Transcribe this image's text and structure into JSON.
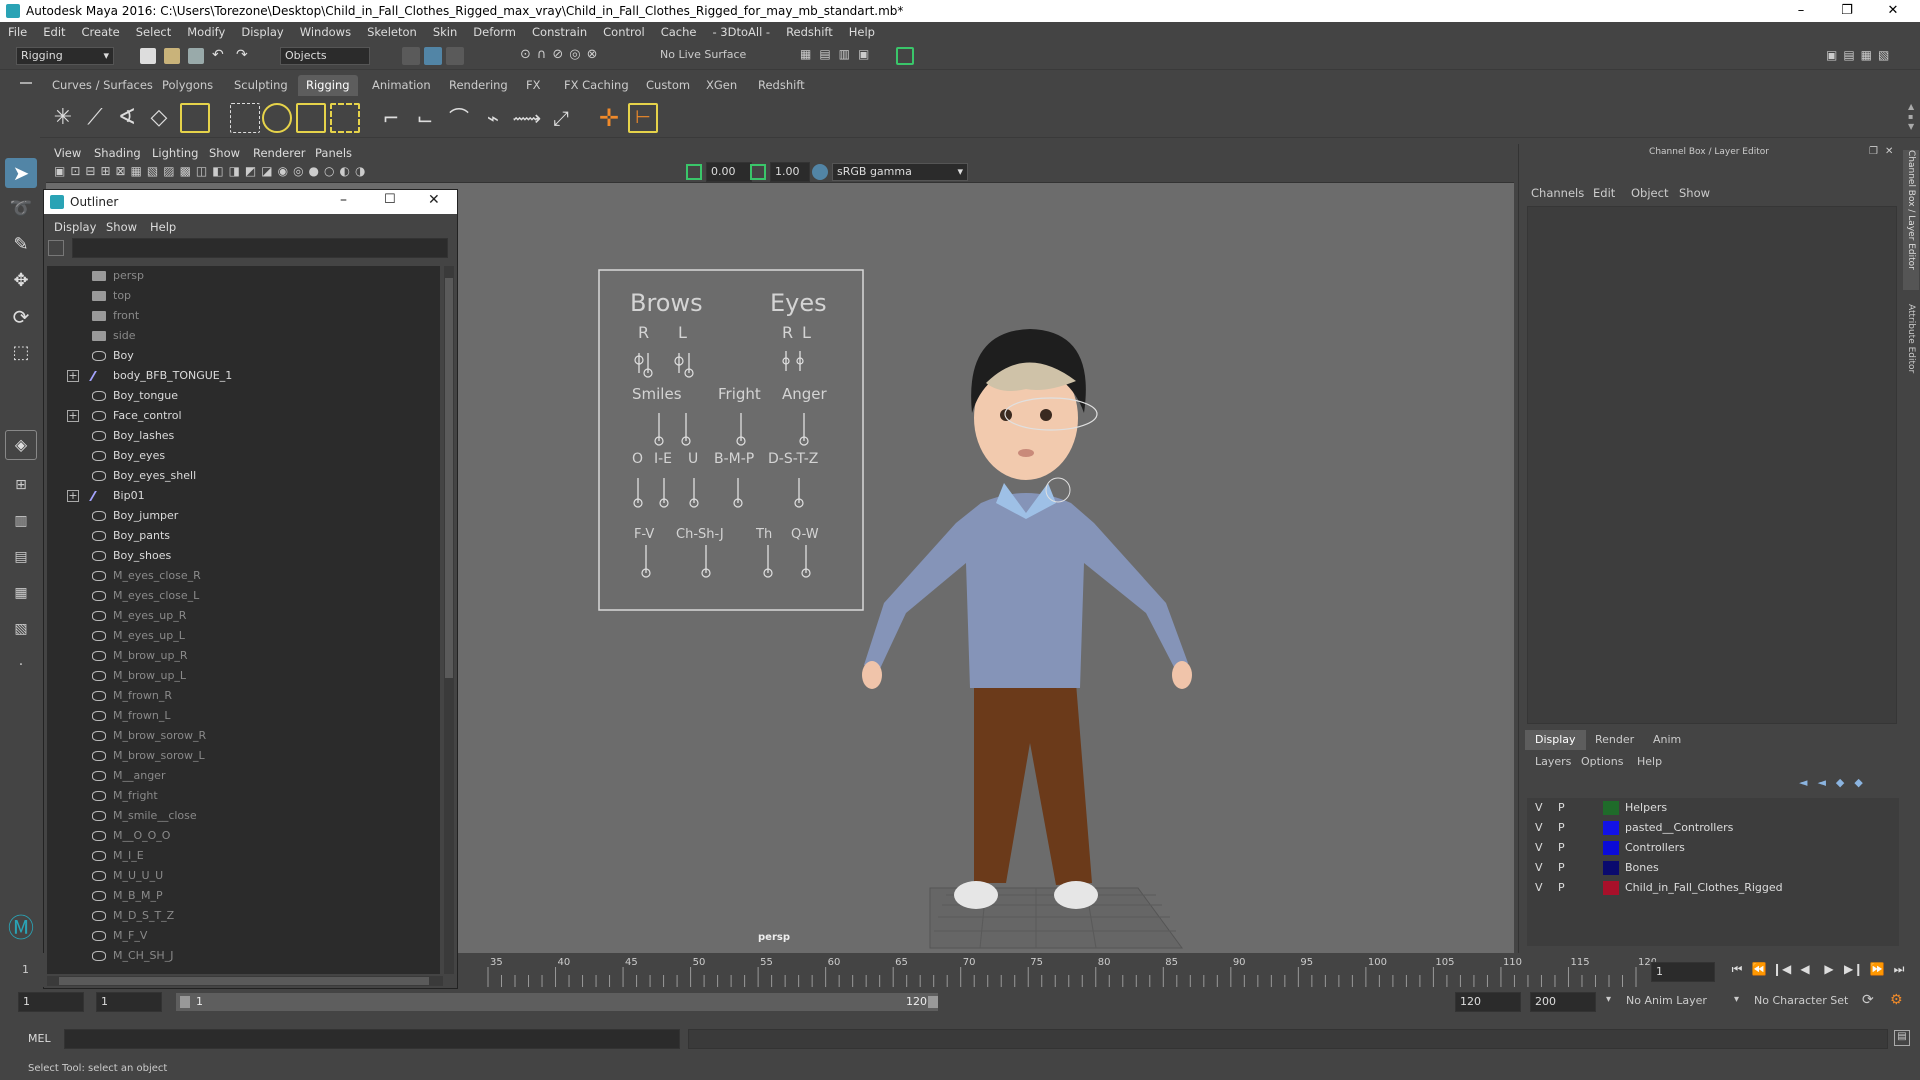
{
  "window": {
    "title": "Autodesk Maya 2016: C:\\Users\\Torezone\\Desktop\\Child_in_Fall_Clothes_Rigged_max_vray\\Child_in_Fall_Clothes_Rigged_for_may_mb_standart.mb*",
    "minimize": "–",
    "maximize": "❐",
    "close": "✕"
  },
  "menubar": [
    "File",
    "Edit",
    "Create",
    "Select",
    "Modify",
    "Display",
    "Windows",
    "Skeleton",
    "Skin",
    "Deform",
    "Constrain",
    "Control",
    "Cache",
    "- 3DtoAll -",
    "Redshift",
    "Help"
  ],
  "status": {
    "mode": "Rigging",
    "objects": "Objects",
    "live_surface": "No Live Surface"
  },
  "shelf_tabs": [
    "Curves / Surfaces",
    "Polygons",
    "Sculpting",
    "Rigging",
    "Animation",
    "Rendering",
    "FX",
    "FX Caching",
    "Custom",
    "XGen",
    "Redshift"
  ],
  "shelf_active": "Rigging",
  "viewport": {
    "menus": [
      "View",
      "Shading",
      "Lighting",
      "Show",
      "Renderer",
      "Panels"
    ],
    "exposure": "0.00",
    "gamma": "1.00",
    "color_space": "sRGB gamma",
    "camera_label": "persp"
  },
  "face_rig": {
    "brows": "Brows",
    "eyes": "Eyes",
    "r": "R",
    "l": "L",
    "smiles": "Smiles",
    "fright": "Fright",
    "anger": "Anger",
    "o": "O",
    "ie": "I-E",
    "u": "U",
    "bmp": "B-M-P",
    "dstz": "D-S-T-Z",
    "fv": "F-V",
    "chshj": "Ch-Sh-J",
    "th": "Th",
    "qw": "Q-W"
  },
  "outliner": {
    "title": "Outliner",
    "menus": [
      "Display",
      "Show",
      "Help"
    ],
    "items": [
      {
        "label": "persp",
        "icon": "camera-icon",
        "dim": true,
        "expander": false
      },
      {
        "label": "top",
        "icon": "camera-icon",
        "dim": true,
        "expander": false
      },
      {
        "label": "front",
        "icon": "camera-icon",
        "dim": true,
        "expander": false
      },
      {
        "label": "side",
        "icon": "camera-icon",
        "dim": true,
        "expander": false
      },
      {
        "label": "Boy",
        "icon": "mesh-icon",
        "dim": false,
        "expander": false
      },
      {
        "label": "body_BFB_TONGUE_1",
        "icon": "joint-icon",
        "dim": false,
        "expander": true
      },
      {
        "label": "Boy_tongue",
        "icon": "mesh-icon",
        "dim": false,
        "expander": false
      },
      {
        "label": "Face_control",
        "icon": "mesh-icon",
        "dim": false,
        "expander": true
      },
      {
        "label": "Boy_lashes",
        "icon": "mesh-icon",
        "dim": false,
        "expander": false
      },
      {
        "label": "Boy_eyes",
        "icon": "mesh-icon",
        "dim": false,
        "expander": false
      },
      {
        "label": "Boy_eyes_shell",
        "icon": "mesh-icon",
        "dim": false,
        "expander": false
      },
      {
        "label": "Bip01",
        "icon": "joint-icon",
        "dim": false,
        "expander": true
      },
      {
        "label": "Boy_jumper",
        "icon": "mesh-icon",
        "dim": false,
        "expander": false
      },
      {
        "label": "Boy_pants",
        "icon": "mesh-icon",
        "dim": false,
        "expander": false
      },
      {
        "label": "Boy_shoes",
        "icon": "mesh-icon",
        "dim": false,
        "expander": false
      },
      {
        "label": "M_eyes_close_R",
        "icon": "mesh-icon",
        "dim": true,
        "expander": false
      },
      {
        "label": "M_eyes_close_L",
        "icon": "mesh-icon",
        "dim": true,
        "expander": false
      },
      {
        "label": "M_eyes_up_R",
        "icon": "mesh-icon",
        "dim": true,
        "expander": false
      },
      {
        "label": "M_eyes_up_L",
        "icon": "mesh-icon",
        "dim": true,
        "expander": false
      },
      {
        "label": "M_brow_up_R",
        "icon": "mesh-icon",
        "dim": true,
        "expander": false
      },
      {
        "label": "M_brow_up_L",
        "icon": "mesh-icon",
        "dim": true,
        "expander": false
      },
      {
        "label": "M_frown_R",
        "icon": "mesh-icon",
        "dim": true,
        "expander": false
      },
      {
        "label": "M_frown_L",
        "icon": "mesh-icon",
        "dim": true,
        "expander": false
      },
      {
        "label": "M_brow_sorow_R",
        "icon": "mesh-icon",
        "dim": true,
        "expander": false
      },
      {
        "label": "M_brow_sorow_L",
        "icon": "mesh-icon",
        "dim": true,
        "expander": false
      },
      {
        "label": "M__anger",
        "icon": "mesh-icon",
        "dim": true,
        "expander": false
      },
      {
        "label": "M_fright",
        "icon": "mesh-icon",
        "dim": true,
        "expander": false
      },
      {
        "label": "M_smile__close",
        "icon": "mesh-icon",
        "dim": true,
        "expander": false
      },
      {
        "label": "M__O_O_O",
        "icon": "mesh-icon",
        "dim": true,
        "expander": false
      },
      {
        "label": "M_I_E",
        "icon": "mesh-icon",
        "dim": true,
        "expander": false
      },
      {
        "label": "M_U_U_U",
        "icon": "mesh-icon",
        "dim": true,
        "expander": false
      },
      {
        "label": "M_B_M_P",
        "icon": "mesh-icon",
        "dim": true,
        "expander": false
      },
      {
        "label": "M_D_S_T_Z",
        "icon": "mesh-icon",
        "dim": true,
        "expander": false
      },
      {
        "label": "M_F_V",
        "icon": "mesh-icon",
        "dim": true,
        "expander": false
      },
      {
        "label": "M_CH_SH_J",
        "icon": "mesh-icon",
        "dim": true,
        "expander": false
      }
    ]
  },
  "channel_box": {
    "title": "Channel Box / Layer Editor",
    "menus": [
      "Channels",
      "Edit",
      "Object",
      "Show"
    ],
    "side_tabs": [
      "Channel Box / Layer Editor",
      "Attribute Editor"
    ],
    "layer_tabs": [
      "Display",
      "Render",
      "Anim"
    ],
    "layer_menus": [
      "Layers",
      "Options",
      "Help"
    ],
    "layers": [
      {
        "v": "V",
        "p": "P",
        "name": "Helpers",
        "color": "#1f6b2a"
      },
      {
        "v": "V",
        "p": "P",
        "name": "pasted__Controllers",
        "color": "#1212e6"
      },
      {
        "v": "V",
        "p": "P",
        "name": "Controllers",
        "color": "#0b0bd8"
      },
      {
        "v": "V",
        "p": "P",
        "name": "Bones",
        "color": "#0a0a6e"
      },
      {
        "v": "V",
        "p": "P",
        "name": "Child_in_Fall_Clothes_Rigged",
        "color": "#a8102a"
      }
    ]
  },
  "timeline": {
    "ticks": [
      "35",
      "40",
      "45",
      "50",
      "55",
      "60",
      "65",
      "70",
      "75",
      "80",
      "85",
      "90",
      "95",
      "100",
      "105",
      "110",
      "115",
      "120"
    ],
    "current_frame": "1",
    "current_frame_left": "1"
  },
  "range": {
    "start": "1",
    "playback_start": "1",
    "slider_start": "1",
    "slider_end": "120",
    "playback_end": "120",
    "end": "200",
    "anim_layer": "No Anim Layer",
    "character_set": "No Character Set"
  },
  "command": {
    "label": "MEL"
  },
  "help_line": "Select Tool: select an object",
  "colors": {
    "accent": "#5285a6",
    "panel": "#444444",
    "viewport": "#6c6c6c"
  }
}
